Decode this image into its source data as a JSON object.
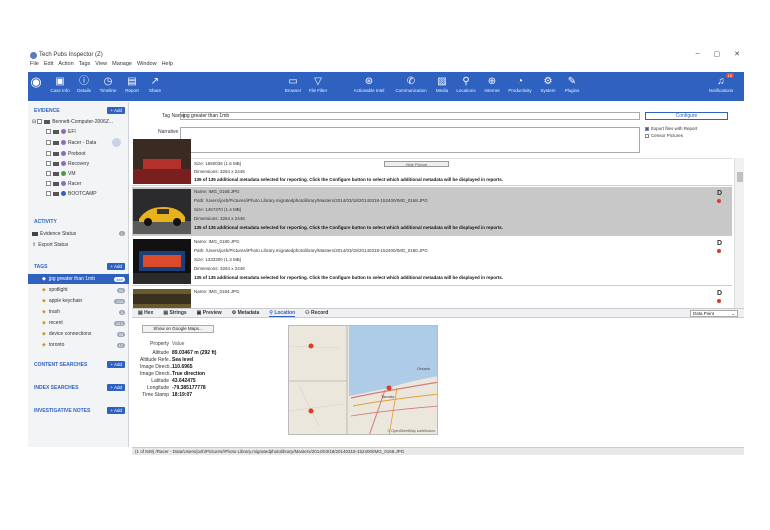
{
  "app": {
    "title": "Tech Pubs Inspector (Z)",
    "window_buttons": [
      "–",
      "▢",
      "✕"
    ]
  },
  "menu": [
    "File",
    "Edit",
    "Action",
    "Tags",
    "View",
    "Manage",
    "Window",
    "Help"
  ],
  "toolbar": {
    "left": [
      {
        "label": "Case Info",
        "icon": "briefcase-icon"
      },
      {
        "label": "Details",
        "icon": "info-icon"
      },
      {
        "label": "Timeline",
        "icon": "clock-icon"
      },
      {
        "label": "Report",
        "icon": "report-icon"
      },
      {
        "label": "Share",
        "icon": "share-icon"
      }
    ],
    "right": [
      {
        "label": "Browser",
        "icon": "folder-icon"
      },
      {
        "label": "File Filter",
        "icon": "filter-icon"
      },
      {
        "label": "Actionable Intel",
        "icon": "intel-icon"
      },
      {
        "label": "Communication",
        "icon": "phone-icon"
      },
      {
        "label": "Media",
        "icon": "image-icon"
      },
      {
        "label": "Locations",
        "icon": "pin-icon"
      },
      {
        "label": "Internet",
        "icon": "globe-icon"
      },
      {
        "label": "Productivity",
        "icon": "gauge-icon"
      },
      {
        "label": "System",
        "icon": "cog-icon"
      },
      {
        "label": "Plugins",
        "icon": "plug-icon"
      }
    ],
    "notifications": {
      "label": "Notifications",
      "badge": "10"
    }
  },
  "sidebar": {
    "evidence": {
      "heading": "EVIDENCE",
      "add_label": "+ Add",
      "root": "Bennett-Computer-2006Z...",
      "items": [
        {
          "label": "EFI",
          "color": "#8e6bbf"
        },
        {
          "label": "Racer - Data",
          "color": "#8e6bbf"
        },
        {
          "label": "Preboot",
          "color": "#8e6bbf"
        },
        {
          "label": "Recovery",
          "color": "#8e6bbf"
        },
        {
          "label": "VM",
          "color": "#4a9b4a"
        },
        {
          "label": "Racer",
          "color": "#8e6bbf"
        },
        {
          "label": "BOOTCAMP",
          "color": "#2f62c0"
        }
      ]
    },
    "activity": {
      "heading": "ACTIVITY",
      "items": [
        {
          "label": "Evidence Status",
          "count": "1"
        },
        {
          "label": "Export Status",
          "count": ""
        }
      ]
    },
    "tags": {
      "heading": "TAGS",
      "add_label": "+ Add",
      "items": [
        {
          "label": "jpg greater than 1mb",
          "count": "849",
          "selected": true
        },
        {
          "label": "spotlight",
          "count": "30",
          "selected": false
        },
        {
          "label": "apple keychain",
          "count": "234",
          "selected": false
        },
        {
          "label": "trash",
          "count": "5",
          "selected": false
        },
        {
          "label": "recent",
          "count": "510",
          "selected": false
        },
        {
          "label": "device connections",
          "count": "35",
          "selected": false
        },
        {
          "label": "toronto",
          "count": "12",
          "selected": false
        }
      ]
    },
    "content_searches": {
      "heading": "CONTENT SEARCHES",
      "add_label": "+ Add"
    },
    "index_searches": {
      "heading": "INDEX SEARCHES",
      "add_label": "+ Add"
    },
    "investigative_notes": {
      "heading": "INVESTIGATIVE NOTES",
      "add_label": "+ Add"
    }
  },
  "tag_editor": {
    "tag_name_label": "Tag Name",
    "tag_name_value": "jpg greater than 1mb",
    "narrative_label": "Narrative",
    "configure_label": "Configure",
    "export_files_label": "Export files with Report",
    "censor_label": "Censor Pictures"
  },
  "results": {
    "hide_picture_label": "Hide Picture",
    "rows": [
      {
        "lines": [
          "Size: 1650036 (1.6 MB)",
          "Dimensions: 3264 x 2448"
        ],
        "note": "135 of 135 additional metadata selected for reporting. Click the Configure button to select which additional metadata will be displayed in reports.",
        "highlight": false
      },
      {
        "lines": [
          "Name: IMG_0168.JPG",
          "Path: /Users/josh/Pictures/iPhoto Library.migratedphotolibrary/Masters/2014/03/18/20140318-152400/IMG_0168.JPG",
          "Size: 1467370 (1.4 MB)",
          "Dimensions: 3264 x 2448"
        ],
        "note": "135 of 135 additional metadata selected for reporting. Click the Configure button to select which additional metadata will be displayed in reports.",
        "highlight": true
      },
      {
        "lines": [
          "Name: IMG_0180.JPG",
          "Path: /Users/josh/Pictures/iPhoto Library.migratedphotolibrary/Masters/2014/03/18/20140318-152400/IMG_0180.JPG",
          "Size: 1333300 (1.3 MB)",
          "Dimensions: 3264 x 2448"
        ],
        "note": "135 of 135 additional metadata selected for reporting. Click the Configure button to select which additional metadata will be displayed in reports.",
        "highlight": false
      },
      {
        "lines": [
          "Name: IMG_0184.JPG"
        ],
        "note": "",
        "highlight": false
      }
    ]
  },
  "tabs": {
    "items": [
      "Hex",
      "Strings",
      "Preview",
      "Metadata",
      "Location",
      "Record"
    ],
    "active": "Location",
    "dropdown": "Data Point"
  },
  "location": {
    "gmaps_label": "Show on Google Maps...",
    "header_property": "Property",
    "header_value": "Value",
    "props": [
      {
        "k": "Altitude",
        "v": "89.03467 m (292 ft)"
      },
      {
        "k": "Altitude Refe...",
        "v": "Sea level"
      },
      {
        "k": "Image Directi...",
        "v": "110.6965"
      },
      {
        "k": "Image Directi...",
        "v": "True direction"
      },
      {
        "k": "Latitude",
        "v": "43.642475"
      },
      {
        "k": "Longitude",
        "v": "-79.385177778"
      },
      {
        "k": "Time Stamp",
        "v": "18:19:07"
      }
    ],
    "map_labels": {
      "city": "Toronto",
      "lake": "Ontario",
      "credit": "© OpenStreetMap contributors"
    }
  },
  "status": {
    "text": "(1 of 849)  /Racer - Data/Users/josh/Pictures/iPhoto Library.migratedphotolibrary/Masters/2014/03/18/20140318-152400/IMG_0168.JPG"
  }
}
